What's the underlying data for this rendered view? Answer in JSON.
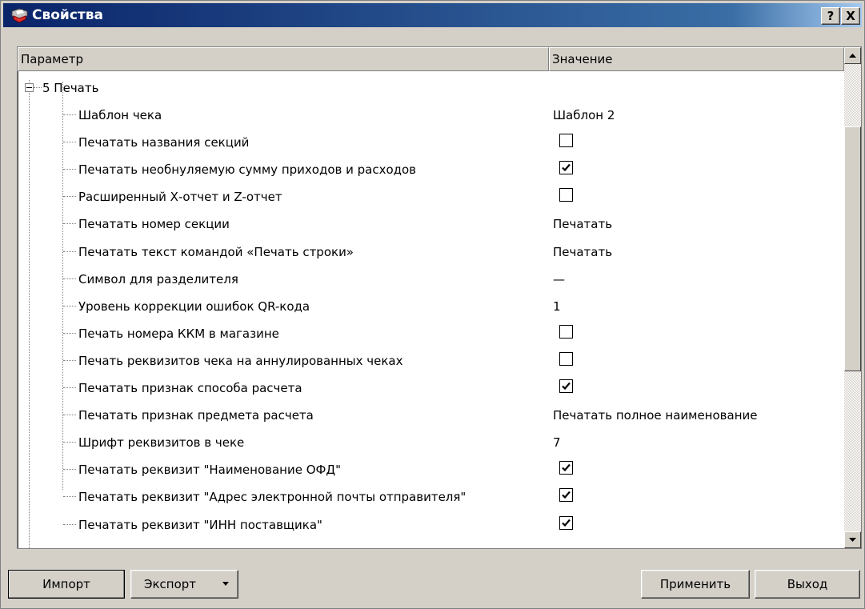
{
  "window": {
    "title": "Свойства",
    "help_label": "?",
    "close_label": "X"
  },
  "header": {
    "param": "Параметр",
    "value": "Значение"
  },
  "group": {
    "label": "5 Печать",
    "expander": "⊟"
  },
  "rows": [
    {
      "label": "Шаблон чека",
      "type": "text",
      "value": "Шаблон 2"
    },
    {
      "label": "Печатать названия секций",
      "type": "checkbox",
      "checked": false
    },
    {
      "label": "Печатать необнуляемую сумму приходов и расходов",
      "type": "checkbox",
      "checked": true
    },
    {
      "label": "Расширенный Х-отчет и Z-отчет",
      "type": "checkbox",
      "checked": false
    },
    {
      "label": "Печатать номер секции",
      "type": "text",
      "value": "Печатать"
    },
    {
      "label": "Печатать текст командой «Печать строки»",
      "type": "text",
      "value": "Печатать"
    },
    {
      "label": "Символ для разделителя",
      "type": "text",
      "value": "—"
    },
    {
      "label": "Уровень коррекции ошибок QR-кода",
      "type": "text",
      "value": "1"
    },
    {
      "label": "Печать номера ККМ в магазине",
      "type": "checkbox",
      "checked": false
    },
    {
      "label": "Печать реквизитов чека на аннулированных чеках",
      "type": "checkbox",
      "checked": false
    },
    {
      "label": "Печатать признак способа расчета",
      "type": "checkbox",
      "checked": true
    },
    {
      "label": "Печатать признак предмета расчета",
      "type": "text",
      "value": "Печатать полное наименование"
    },
    {
      "label": "Шрифт реквизитов в чеке",
      "type": "text",
      "value": "7"
    },
    {
      "label": "Печатать реквизит \"Наименование ОФД\"",
      "type": "checkbox",
      "checked": true
    },
    {
      "label": "Печатать реквизит \"Адрес электронной почты отправителя\"",
      "type": "checkbox",
      "checked": true
    },
    {
      "label": "Печатать реквизит \"ИНН поставщика\"",
      "type": "checkbox",
      "checked": true
    }
  ],
  "buttons": {
    "import": "Импорт",
    "export": "Экспорт",
    "apply": "Применить",
    "exit": "Выход"
  },
  "scrollbar": {
    "position": 0.2
  },
  "colors": {
    "title_start": "#0a246a",
    "title_end": "#a6caf0",
    "face": "#d4d0c8"
  }
}
